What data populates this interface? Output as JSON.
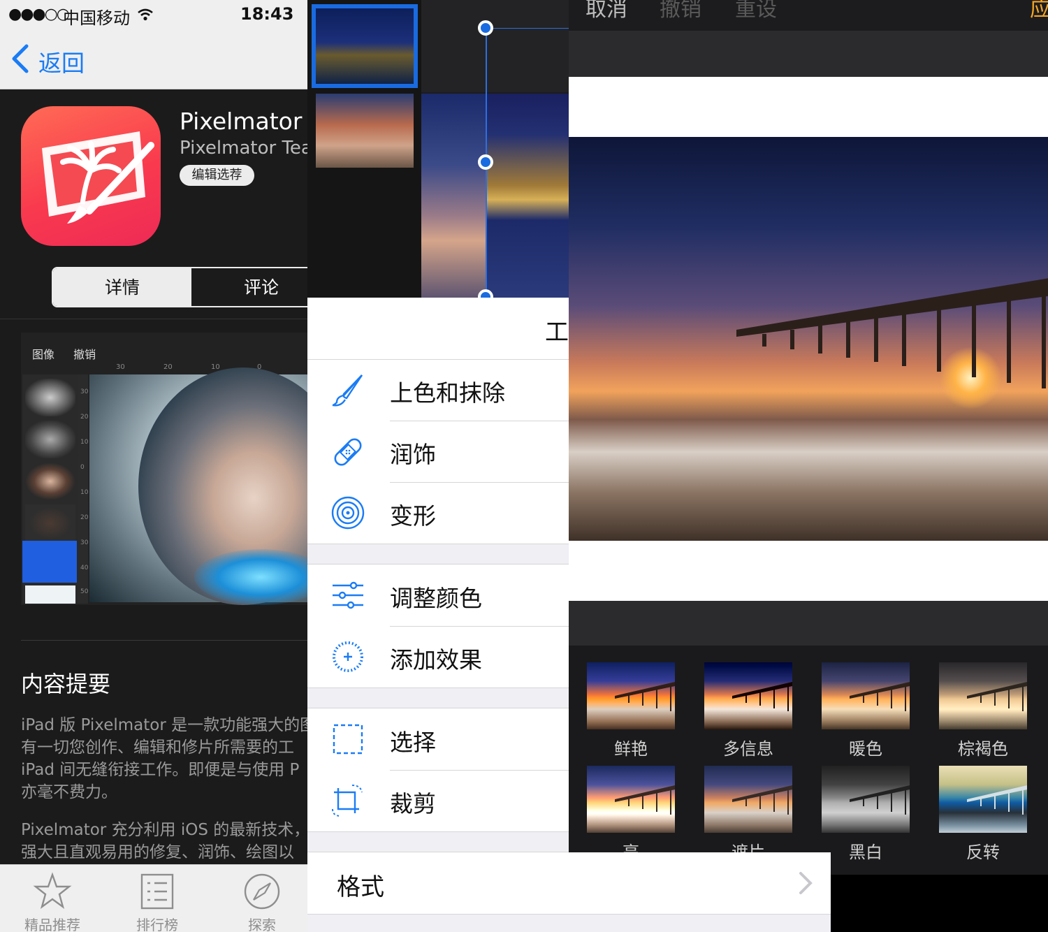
{
  "status_bar": {
    "signal": "●●●○○",
    "carrier": "中国移动",
    "time": "18:43"
  },
  "nav": {
    "back_label": "返回"
  },
  "app": {
    "name": "Pixelmator",
    "developer": "Pixelmator Tea",
    "badge": "编辑选荐",
    "segments": {
      "details": "详情",
      "reviews": "评论"
    }
  },
  "screenshot": {
    "toolbar": [
      "图像",
      "撤销"
    ],
    "ruler": [
      "30",
      "20",
      "10",
      "0"
    ],
    "vruler": [
      "30",
      "20",
      "10",
      "0",
      "10",
      "20",
      "30",
      "40",
      "50"
    ]
  },
  "description": {
    "title": "内容提要",
    "lines": [
      "iPad 版 Pixelmator 是一款功能强大的图",
      "有一切您创作、编辑和修片所需要的工",
      "iPad 间无缝衔接工作。即便是与使用 P",
      "亦毫不费力。"
    ],
    "lines2": [
      "Pixelmator 充分利用 iOS 的最新技术，",
      "强大且直观易用的修复、润饰、绘图以"
    ]
  },
  "tabbar": [
    {
      "label": "精品推荐",
      "icon": "star-icon"
    },
    {
      "label": "排行榜",
      "icon": "list-icon"
    },
    {
      "label": "探索",
      "icon": "compass-icon"
    }
  ],
  "tools_menu": {
    "title": "工",
    "groups": [
      [
        {
          "label": "上色和抹除",
          "icon": "brush-icon"
        },
        {
          "label": "润饰",
          "icon": "bandage-icon"
        },
        {
          "label": "变形",
          "icon": "spiral-icon"
        }
      ],
      [
        {
          "label": "调整颜色",
          "icon": "sliders-icon"
        },
        {
          "label": "添加效果",
          "icon": "effects-icon"
        }
      ],
      [
        {
          "label": "选择",
          "icon": "selection-icon"
        },
        {
          "label": "裁剪",
          "icon": "crop-icon"
        }
      ]
    ],
    "format_label": "格式"
  },
  "effects_screen": {
    "toolbar": {
      "cancel": "取消",
      "undo": "撤销",
      "reset": "重设",
      "apply": "应"
    },
    "effects": [
      "鲜艳",
      "多信息",
      "暖色",
      "棕褐色",
      "亮",
      "遮片",
      "黑白",
      "反转"
    ]
  },
  "colors": {
    "accent_blue": "#1a7cf5",
    "app_icon": "#f93a4e",
    "apply_orange": "#f5a623"
  }
}
